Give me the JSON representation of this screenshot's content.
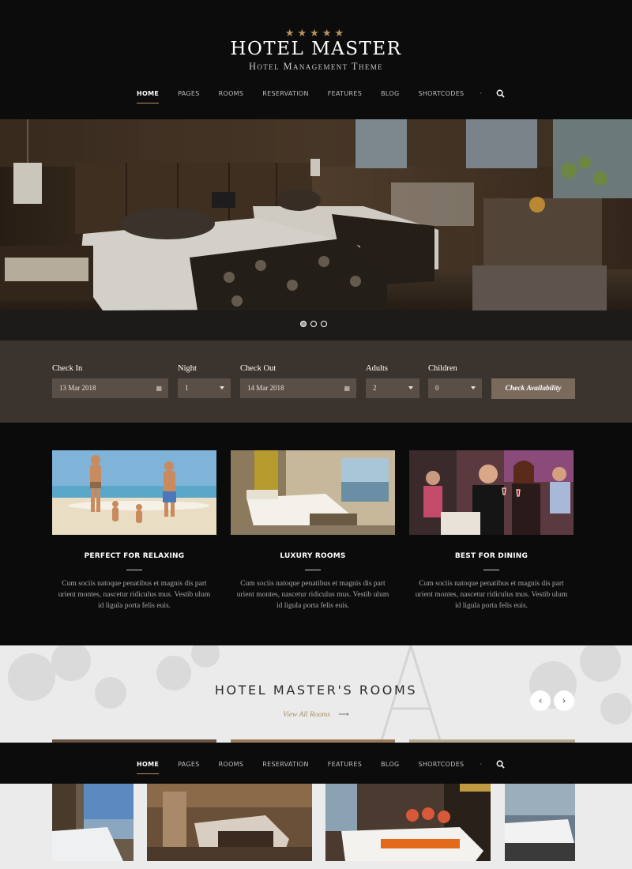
{
  "header": {
    "stars": "★★★★★",
    "title": "HOTEL MASTER",
    "subtitle": "Hotel Management Theme"
  },
  "nav": {
    "items": [
      "HOME",
      "PAGES",
      "ROOMS",
      "RESERVATION",
      "FEATURES",
      "BLOG",
      "SHORTCODES"
    ],
    "active": "HOME",
    "separator": "·",
    "search_icon": "search-icon"
  },
  "slider": {
    "bullet_count": 3,
    "active_index": 0
  },
  "booking": {
    "check_in": {
      "label": "Check In",
      "value": "13 Mar 2018",
      "icon": "calendar-icon"
    },
    "night": {
      "label": "Night",
      "value": "1"
    },
    "check_out": {
      "label": "Check Out",
      "value": "14 Mar 2018",
      "icon": "calendar-icon"
    },
    "adults": {
      "label": "Adults",
      "value": "2"
    },
    "children": {
      "label": "Children",
      "value": "0"
    },
    "button": "Check Availability"
  },
  "features": [
    {
      "title": "PERFECT FOR RELAXING",
      "text": "Cum sociis natoque penatibus et magnis dis part urient montes, nascetur ridiculus mus. Vestib ulum id ligula porta felis euis."
    },
    {
      "title": "LUXURY ROOMS",
      "text": "Cum sociis natoque penatibus et magnis dis part urient montes, nascetur ridiculus mus. Vestib ulum id ligula porta felis euis."
    },
    {
      "title": "BEST FOR DINING",
      "text": "Cum sociis natoque penatibus et magnis dis part urient montes, nascetur ridiculus mus. Vestib ulum id ligula porta felis euis."
    }
  ],
  "rooms": {
    "title": "HOTEL MASTER'S ROOMS",
    "link": "View All Rooms",
    "link_arrow": "⟶",
    "prev_icon": "‹",
    "next_icon": "›"
  },
  "colors": {
    "accent": "#b8925c",
    "booking_bg": "#3b332d",
    "field_bg": "#5a4f47",
    "button_bg": "#7a6a5c"
  }
}
